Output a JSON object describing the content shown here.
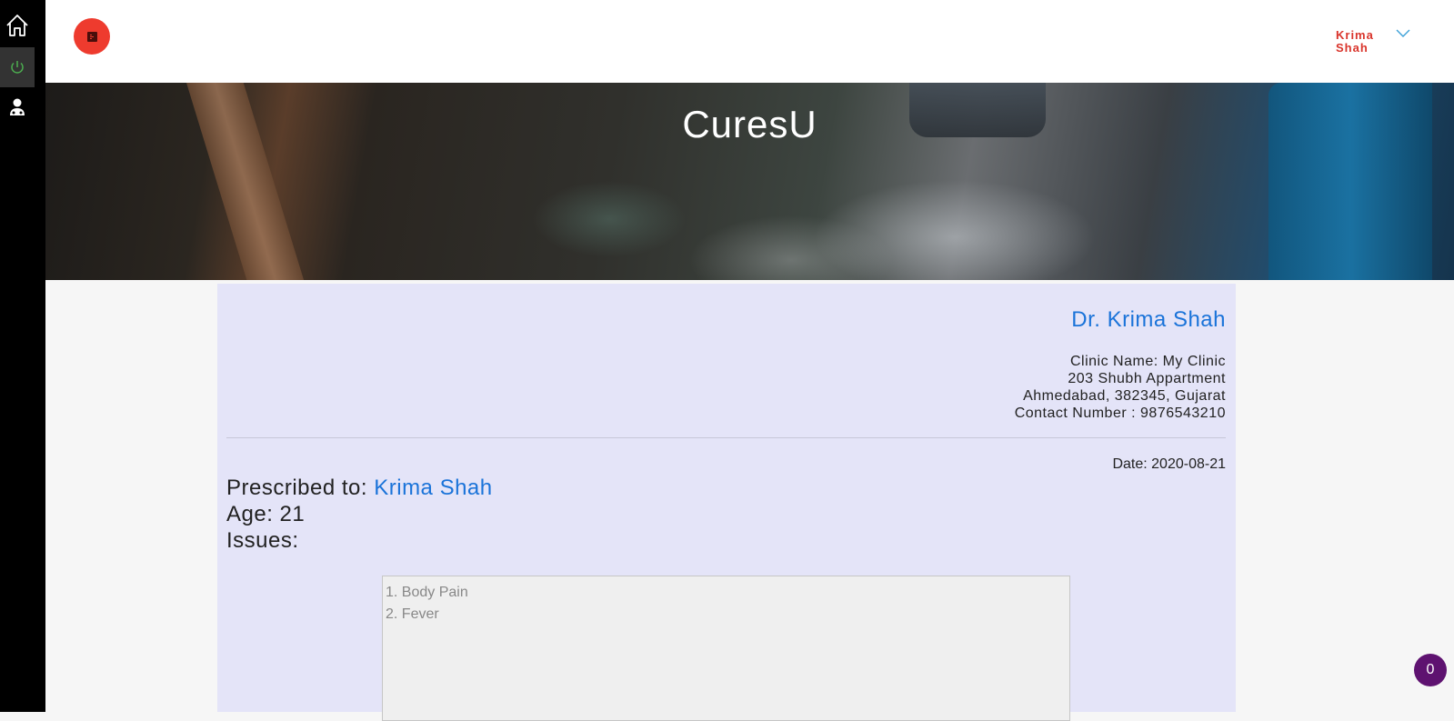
{
  "sidebar": {
    "items": [
      {
        "icon": "home-icon"
      },
      {
        "icon": "power-icon",
        "active": true,
        "color": "#4caf50"
      },
      {
        "icon": "doctor-icon"
      }
    ]
  },
  "header": {
    "logo_icon": "app-logo",
    "user_name": "Krima Shah",
    "menu_icon": "chevron-down-icon"
  },
  "hero": {
    "title": "CuresU"
  },
  "prescription": {
    "doctor_name": "Dr. Krima Shah",
    "clinic_lines": [
      "Clinic Name: My Clinic",
      "203 Shubh Appartment",
      "Ahmedabad, 382345, Gujarat",
      "Contact Number : 9876543210"
    ],
    "date_label": "Date: 2020-08-21",
    "prescribed_label": "Prescribed to: ",
    "patient_name": "Krima Shah",
    "age_label": "Age: 21",
    "issues_label": "Issues:",
    "issues": [
      "1. Body Pain",
      "2. Fever"
    ]
  },
  "badge": {
    "count": "0"
  },
  "colors": {
    "accent_blue": "#1a73d9",
    "brand_red": "#ee3b2e",
    "panel_bg": "#e4e4f8",
    "badge_purple": "#5e1270"
  }
}
